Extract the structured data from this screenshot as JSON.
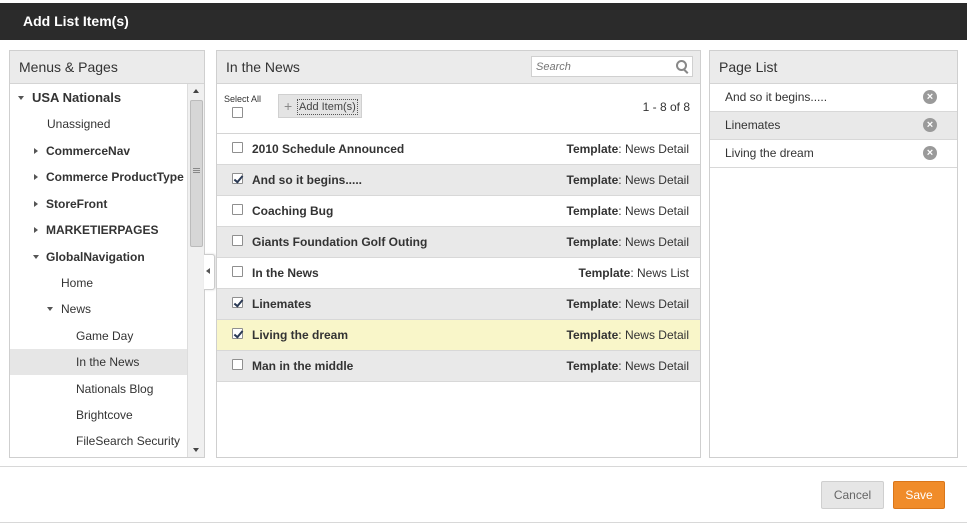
{
  "dialog": {
    "title": "Add List Item(s)"
  },
  "left_panel": {
    "header": "Menus & Pages",
    "tree": [
      {
        "label": "USA Nationals",
        "expanded": true
      },
      {
        "label": "Unassigned"
      },
      {
        "label": "CommerceNav",
        "expanded": false
      },
      {
        "label": "Commerce ProductType",
        "expanded": false
      },
      {
        "label": "StoreFront",
        "expanded": false
      },
      {
        "label": "MARKETIERPAGES",
        "expanded": false
      },
      {
        "label": "GlobalNavigation",
        "expanded": true
      },
      {
        "label": "Home"
      },
      {
        "label": "News",
        "expanded": true
      },
      {
        "label": "Game Day"
      },
      {
        "label": "In the News",
        "selected": true
      },
      {
        "label": "Nationals Blog"
      },
      {
        "label": "Brightcove"
      },
      {
        "label": "FileSearch Security"
      }
    ]
  },
  "middle_panel": {
    "header": "In the News",
    "search_placeholder": "Search",
    "select_all_label": "Select All",
    "add_items_label": "Add Item(s)",
    "count": "1 - 8 of 8",
    "template_label": "Template",
    "items": [
      {
        "title": "2010 Schedule Announced",
        "template": "News Detail",
        "checked": false
      },
      {
        "title": "And so it begins.....",
        "template": "News Detail",
        "checked": true
      },
      {
        "title": "Coaching Bug",
        "template": "News Detail",
        "checked": false
      },
      {
        "title": "Giants Foundation Golf Outing",
        "template": "News Detail",
        "checked": false
      },
      {
        "title": "In the News",
        "template": "News List",
        "checked": false
      },
      {
        "title": "Linemates",
        "template": "News Detail",
        "checked": true
      },
      {
        "title": "Living the dream",
        "template": "News Detail",
        "checked": true,
        "highlighted": true
      },
      {
        "title": "Man in the middle",
        "template": "News Detail",
        "checked": false
      }
    ]
  },
  "right_panel": {
    "header": "Page List",
    "items": [
      {
        "label": "And so it begins....."
      },
      {
        "label": "Linemates"
      },
      {
        "label": "Living the dream"
      }
    ]
  },
  "footer": {
    "cancel_label": "Cancel",
    "save_label": "Save"
  },
  "colors": {
    "titlebar": "#2b2b2b",
    "save_button": "#f08c2a",
    "highlight_row": "#f9f6c9"
  }
}
